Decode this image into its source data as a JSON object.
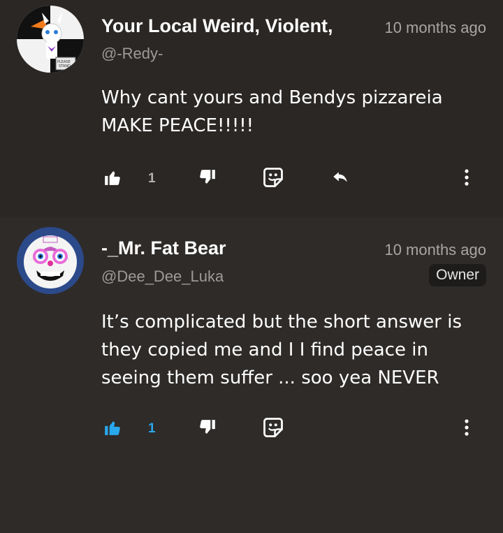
{
  "comments": [
    {
      "author": "Your Local Weird, Violent,",
      "handle": "@-Redy-",
      "time": "10 months ago",
      "text": "Why cant yours and Bendys pizzareia MAKE PEACE!!!!!",
      "likes": "1",
      "liked": false,
      "avatar_sign_text": "PLEASE STAND"
    },
    {
      "author": "-_Mr. Fat Bear",
      "handle": "@Dee_Dee_Luka",
      "time": "10 months ago",
      "badge": "Owner",
      "text": "It’s complicated but the short answer is they copied me and I I find peace in seeing them suffer ... soo yea NEVER",
      "likes": "1",
      "liked": true
    }
  ],
  "colors": {
    "liked_blue": "#29a8ee",
    "icon_white": "#ffffff",
    "muted_text": "#a9a5a2"
  },
  "icons": [
    "thumbs-up-icon",
    "thumbs-down-icon",
    "sticker-icon",
    "reply-icon",
    "more-vertical-icon"
  ]
}
